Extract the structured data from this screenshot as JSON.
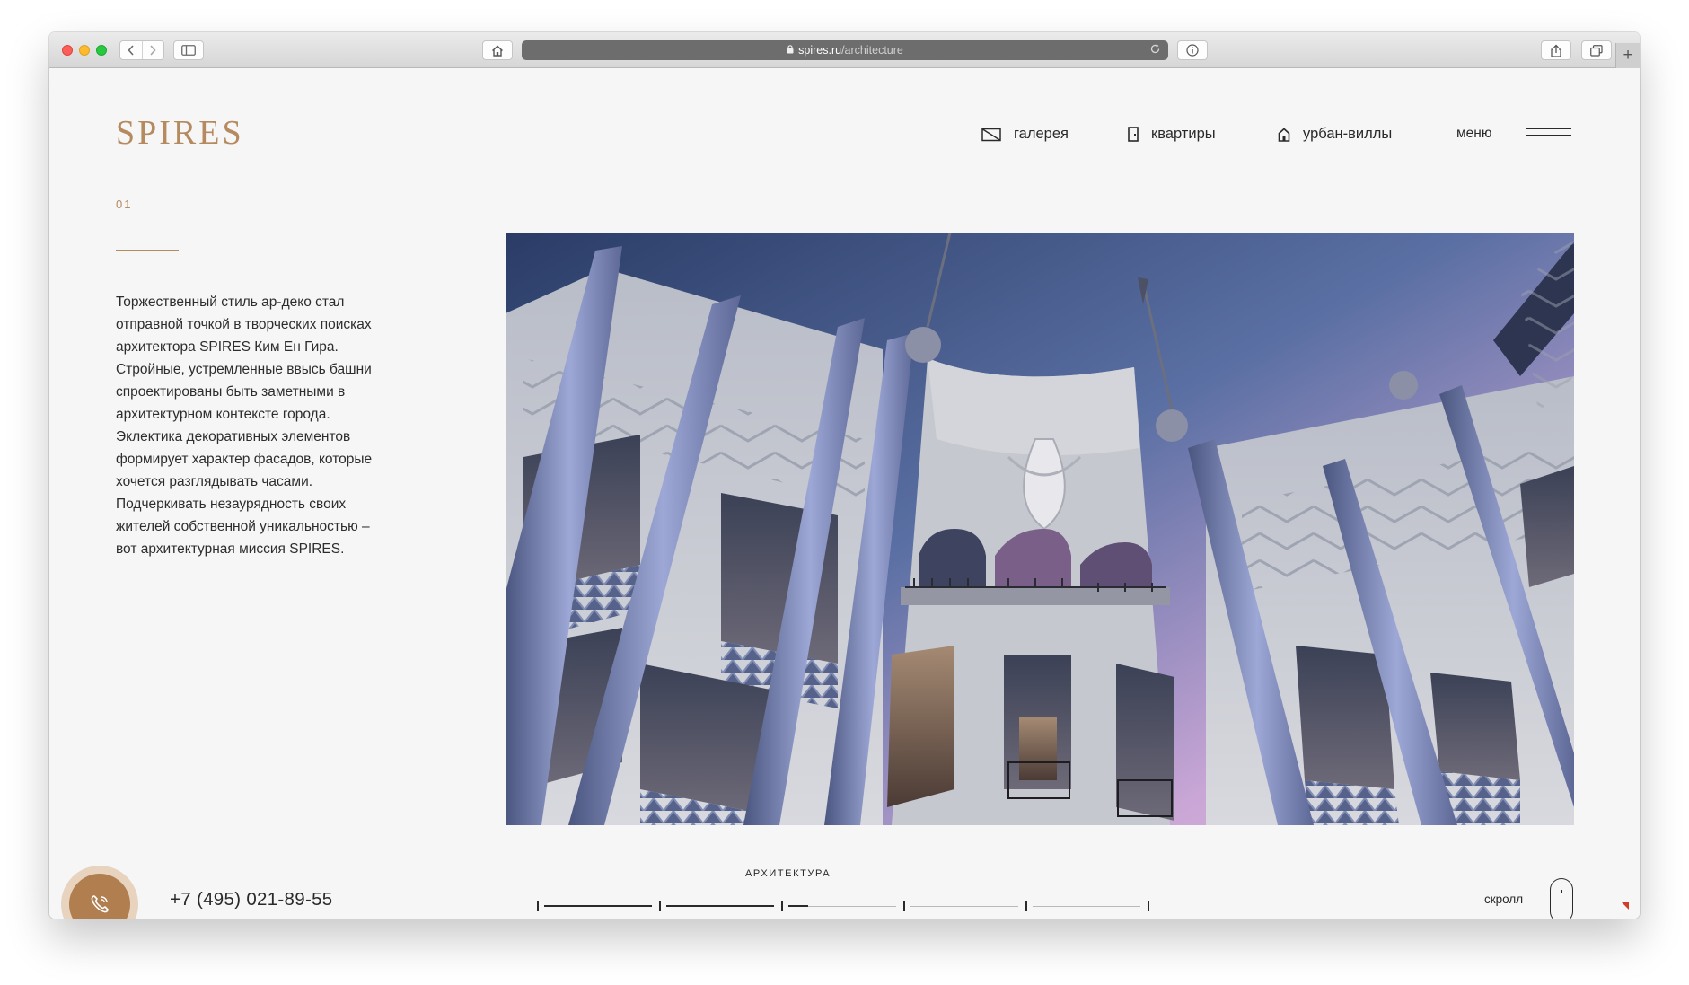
{
  "browser": {
    "url_host": "spires.ru",
    "url_path": "/architecture"
  },
  "header": {
    "logo": "SPIRES",
    "nav": [
      {
        "label": "галерея",
        "icon": "gallery-icon"
      },
      {
        "label": "квартиры",
        "icon": "door-icon"
      },
      {
        "label": "урбан-виллы",
        "icon": "house-icon"
      }
    ],
    "menu_label": "меню"
  },
  "content": {
    "slide_number": "01",
    "description": "Торжественный стиль ар-деко стал отправной точкой в творческих поисках архитектора SPIRES Ким Ен Гира. Стройные, устремленные ввысь башни спроектированы быть заметными в архитектурном контексте города. Эклектика декоративных элементов формирует характер фасадов, которые хочется разглядывать часами. Подчеркивать незаурядность своих жителей собственной уникальностью – вот архитектурная миссия SPIRES."
  },
  "footer": {
    "phone": "+7 (495) 021-89-55",
    "section_label": "АРХИТЕКТУРА",
    "progress": {
      "sections": 5,
      "current_index": 2
    },
    "scroll_label": "скролл"
  },
  "colors": {
    "accent": "#b58a5f",
    "call_button": "#b07e4f"
  }
}
